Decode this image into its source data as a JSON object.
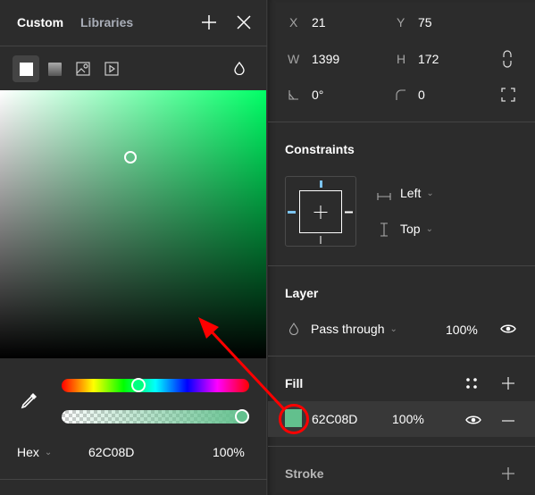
{
  "color_panel": {
    "tabs": [
      {
        "label": "Custom",
        "active": true
      },
      {
        "label": "Libraries",
        "active": false
      }
    ],
    "header_icons": [
      "plus-icon",
      "close-icon"
    ],
    "paint_types": [
      {
        "name": "solid-paint-icon",
        "selected": true
      },
      {
        "name": "gradient-paint-icon",
        "selected": false
      },
      {
        "name": "image-paint-icon",
        "selected": false
      },
      {
        "name": "video-paint-icon",
        "selected": false
      }
    ],
    "blend_icon": "blend-drop-icon",
    "color_format": "Hex",
    "hex_value": "62C08D",
    "opacity": "100%",
    "selected_color": "#62C08D",
    "hue_base": "#00FF66",
    "hue_position": 0.41,
    "alpha_position": 1.0,
    "picker_saturation": 0.49,
    "picker_brightness": 0.75
  },
  "design_panel": {
    "position": {
      "x_label": "X",
      "x_value": "21",
      "y_label": "Y",
      "y_value": "75",
      "w_label": "W",
      "w_value": "1399",
      "h_label": "H",
      "h_value": "172",
      "rotation_value": "0°",
      "radius_value": "0"
    },
    "constraints": {
      "title": "Constraints",
      "horizontal": "Left",
      "vertical": "Top"
    },
    "layer": {
      "title": "Layer",
      "blend_mode": "Pass through",
      "opacity": "100%"
    },
    "fill": {
      "title": "Fill",
      "hex": "62C08D",
      "opacity": "100%",
      "color": "#62C08D"
    },
    "stroke": {
      "title": "Stroke"
    }
  },
  "annotation": {
    "color": "#FF0000",
    "type": "arrow-and-circle"
  }
}
